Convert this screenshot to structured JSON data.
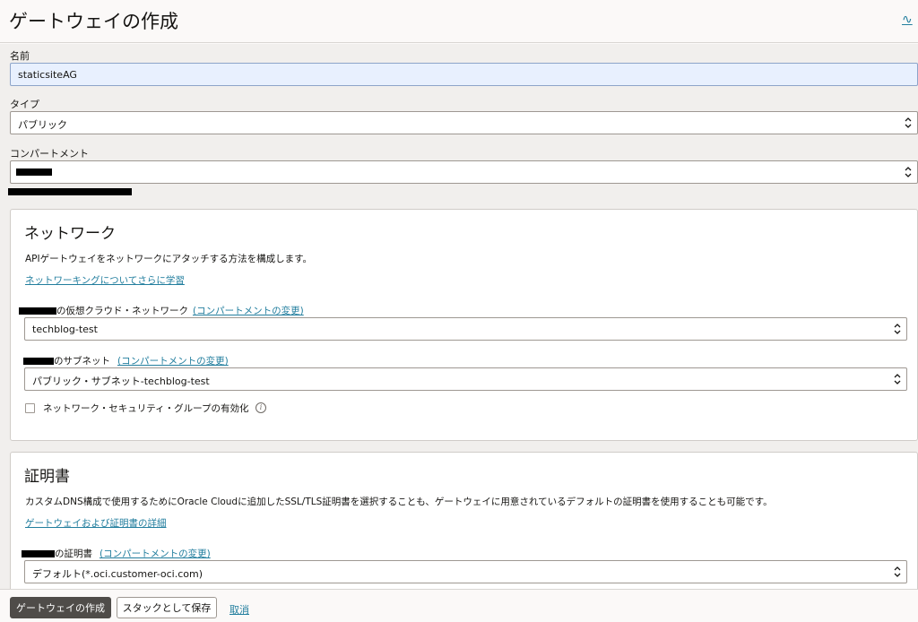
{
  "header": {
    "title": "ゲートウェイの作成",
    "help_icon": "help-wave-icon",
    "help_glyph": "∿"
  },
  "form": {
    "name_label": "名前",
    "name_value": "staticsiteAG",
    "type_label": "タイプ",
    "type_value": "パブリック",
    "compartment_label": "コンパートメント"
  },
  "network": {
    "title": "ネットワーク",
    "description": "APIゲートウェイをネットワークにアタッチする方法を構成します。",
    "learn_link": "ネットワーキングについてさらに学習",
    "vcn_label": "の仮想クラウド・ネットワーク",
    "vcn_change": "(コンパートメントの変更)",
    "vcn_value": "techblog-test",
    "subnet_label": "のサブネット",
    "subnet_change": "(コンパートメントの変更)",
    "subnet_value": "パブリック・サブネット-techblog-test",
    "nsg_label": "ネットワーク・セキュリティ・グループの有効化",
    "info_glyph": "i"
  },
  "certificate": {
    "title": "証明書",
    "description": "カスタムDNS構成で使用するためにOracle Cloudに追加したSSL/TLS証明書を選択することも、ゲートウェイに用意されているデフォルトの証明書を使用することも可能です。",
    "learn_link": "ゲートウェイおよび証明書の詳細",
    "cert_label": "の証明書",
    "cert_change": "(コンパートメントの変更)",
    "cert_value": "デフォルト(*.oci.customer-oci.com)"
  },
  "footer": {
    "create_label": "ゲートウェイの作成",
    "save_stack_label": "スタックとして保存",
    "cancel_label": "取消"
  }
}
